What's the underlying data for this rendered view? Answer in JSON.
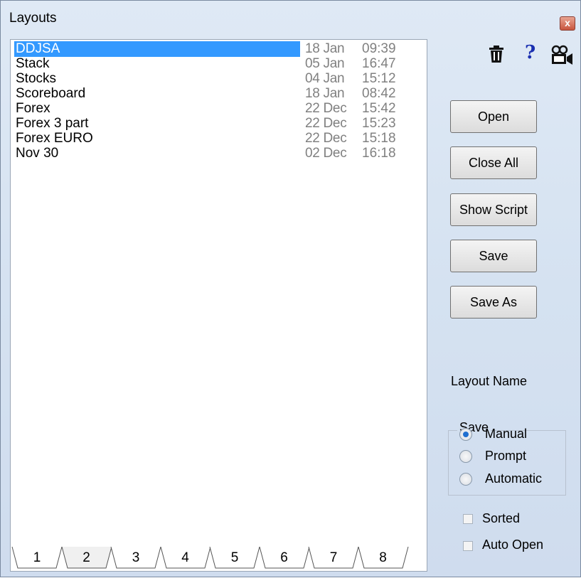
{
  "window": {
    "title": "Layouts",
    "close_label": "x"
  },
  "layouts": [
    {
      "name": "DDJSA",
      "date": "18 Jan",
      "time": "09:39",
      "selected": true
    },
    {
      "name": "Stack",
      "date": "05 Jan",
      "time": "16:47"
    },
    {
      "name": "Stocks",
      "date": "04 Jan",
      "time": "15:12"
    },
    {
      "name": "Scoreboard",
      "date": "18 Jan",
      "time": "08:42"
    },
    {
      "name": "Forex",
      "date": "22 Dec",
      "time": "15:42"
    },
    {
      "name": "Forex 3 part",
      "date": "22 Dec",
      "time": "15:23"
    },
    {
      "name": "Forex EURO",
      "date": "22 Dec",
      "time": "15:18"
    },
    {
      "name": "Nov 30",
      "date": "02 Dec",
      "time": "16:18"
    }
  ],
  "tabs": [
    "1",
    "2",
    "3",
    "4",
    "5",
    "6",
    "7",
    "8"
  ],
  "active_tab": "2",
  "toolbar": {
    "delete_icon": "trash-icon",
    "help_icon": "help-icon",
    "camera_icon": "camera-icon",
    "help_glyph": "?"
  },
  "buttons": {
    "open": "Open",
    "close_all": "Close All",
    "show_script": "Show Script",
    "save": "Save",
    "save_as": "Save As"
  },
  "layout_name_label": "Layout Name",
  "save_group": {
    "legend": "Save",
    "options": [
      "Manual",
      "Prompt",
      "Automatic"
    ],
    "selected": "Manual"
  },
  "checkboxes": {
    "sorted": "Sorted",
    "auto_open": "Auto Open"
  },
  "colors": {
    "selection": "#3399ff",
    "date_text": "#808080"
  }
}
